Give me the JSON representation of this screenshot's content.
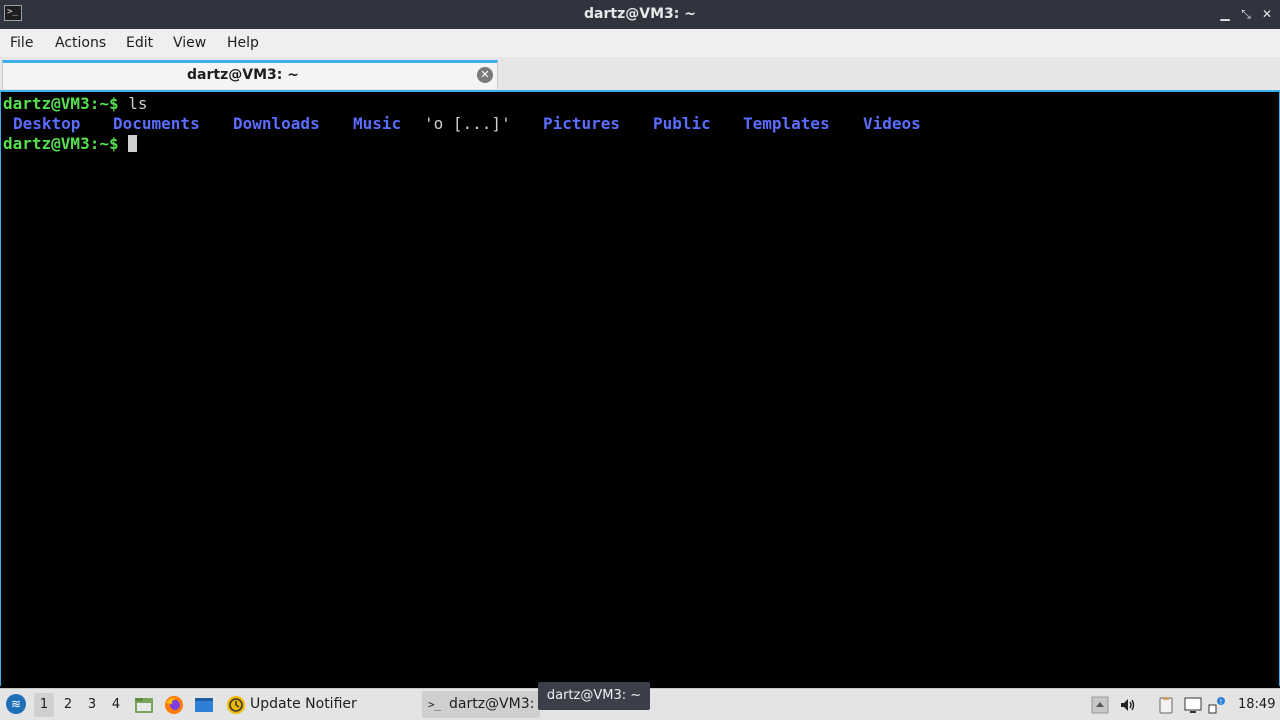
{
  "window": {
    "title": "dartz@VM3: ~",
    "controls": [
      "minimize",
      "restore",
      "close"
    ]
  },
  "menu": {
    "items": [
      "File",
      "Actions",
      "Edit",
      "View",
      "Help"
    ]
  },
  "tabs": [
    {
      "label": "dartz@VM3: ~",
      "close_icon": "close-icon"
    }
  ],
  "terminal": {
    "prompt": "dartz@VM3:~$",
    "command": " ls",
    "listing": [
      {
        "name": "Desktop",
        "type": "dir"
      },
      {
        "name": "Documents",
        "type": "dir"
      },
      {
        "name": "Downloads",
        "type": "dir"
      },
      {
        "name": "Music",
        "type": "dir"
      },
      {
        "name": "'o [...]'",
        "type": "file"
      },
      {
        "name": "Pictures",
        "type": "dir"
      },
      {
        "name": "Public",
        "type": "dir"
      },
      {
        "name": "Templates",
        "type": "dir"
      },
      {
        "name": "Videos",
        "type": "dir"
      }
    ],
    "colors": {
      "prompt": "#55e04d",
      "dir": "#5c6cff",
      "text": "#cfcfcf"
    }
  },
  "taskbar": {
    "workspaces": [
      "1",
      "2",
      "3",
      "4"
    ],
    "active_workspace": "1",
    "tasks": [
      {
        "label": "Update Notifier",
        "icon": "update-notifier-icon"
      },
      {
        "label": "dartz@VM3: ~",
        "icon": "terminal-icon"
      }
    ],
    "tooltip": "dartz@VM3: ~",
    "clock": "18:49",
    "tray_icons": [
      "tray-expand-icon",
      "volume-icon",
      "clipboard-icon",
      "screen-icon",
      "network-icon"
    ]
  },
  "accent": "#3daee9"
}
